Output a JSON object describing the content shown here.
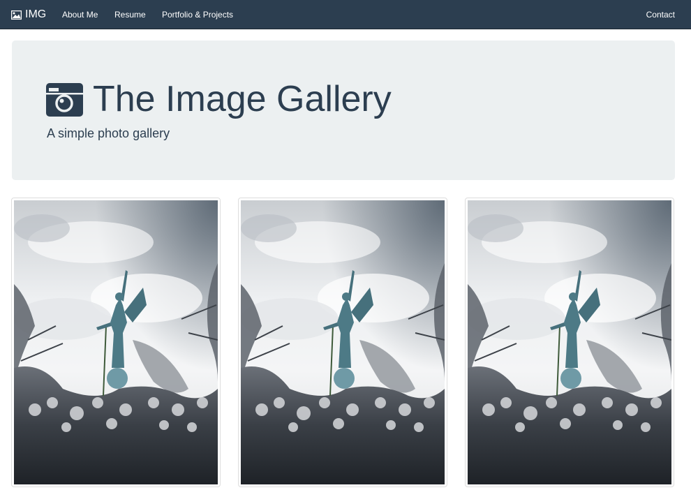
{
  "navbar": {
    "brand_icon": "picture-icon",
    "brand_label": "IMG",
    "links": [
      {
        "label": "About Me"
      },
      {
        "label": "Resume"
      },
      {
        "label": "Portfolio & Projects"
      }
    ],
    "contact_label": "Contact",
    "background_color": "#2c3e50"
  },
  "jumbotron": {
    "icon": "camera-icon",
    "title": "The Image Gallery",
    "subtitle": "A simple photo gallery",
    "background_color": "#ecf0f1",
    "text_color": "#2c3e50"
  },
  "gallery": {
    "images": [
      {
        "subject": "angel statue among blossoming branches under cloudy sky"
      },
      {
        "subject": "angel statue among blossoming branches under cloudy sky"
      },
      {
        "subject": "angel statue among blossoming branches under cloudy sky"
      }
    ]
  }
}
